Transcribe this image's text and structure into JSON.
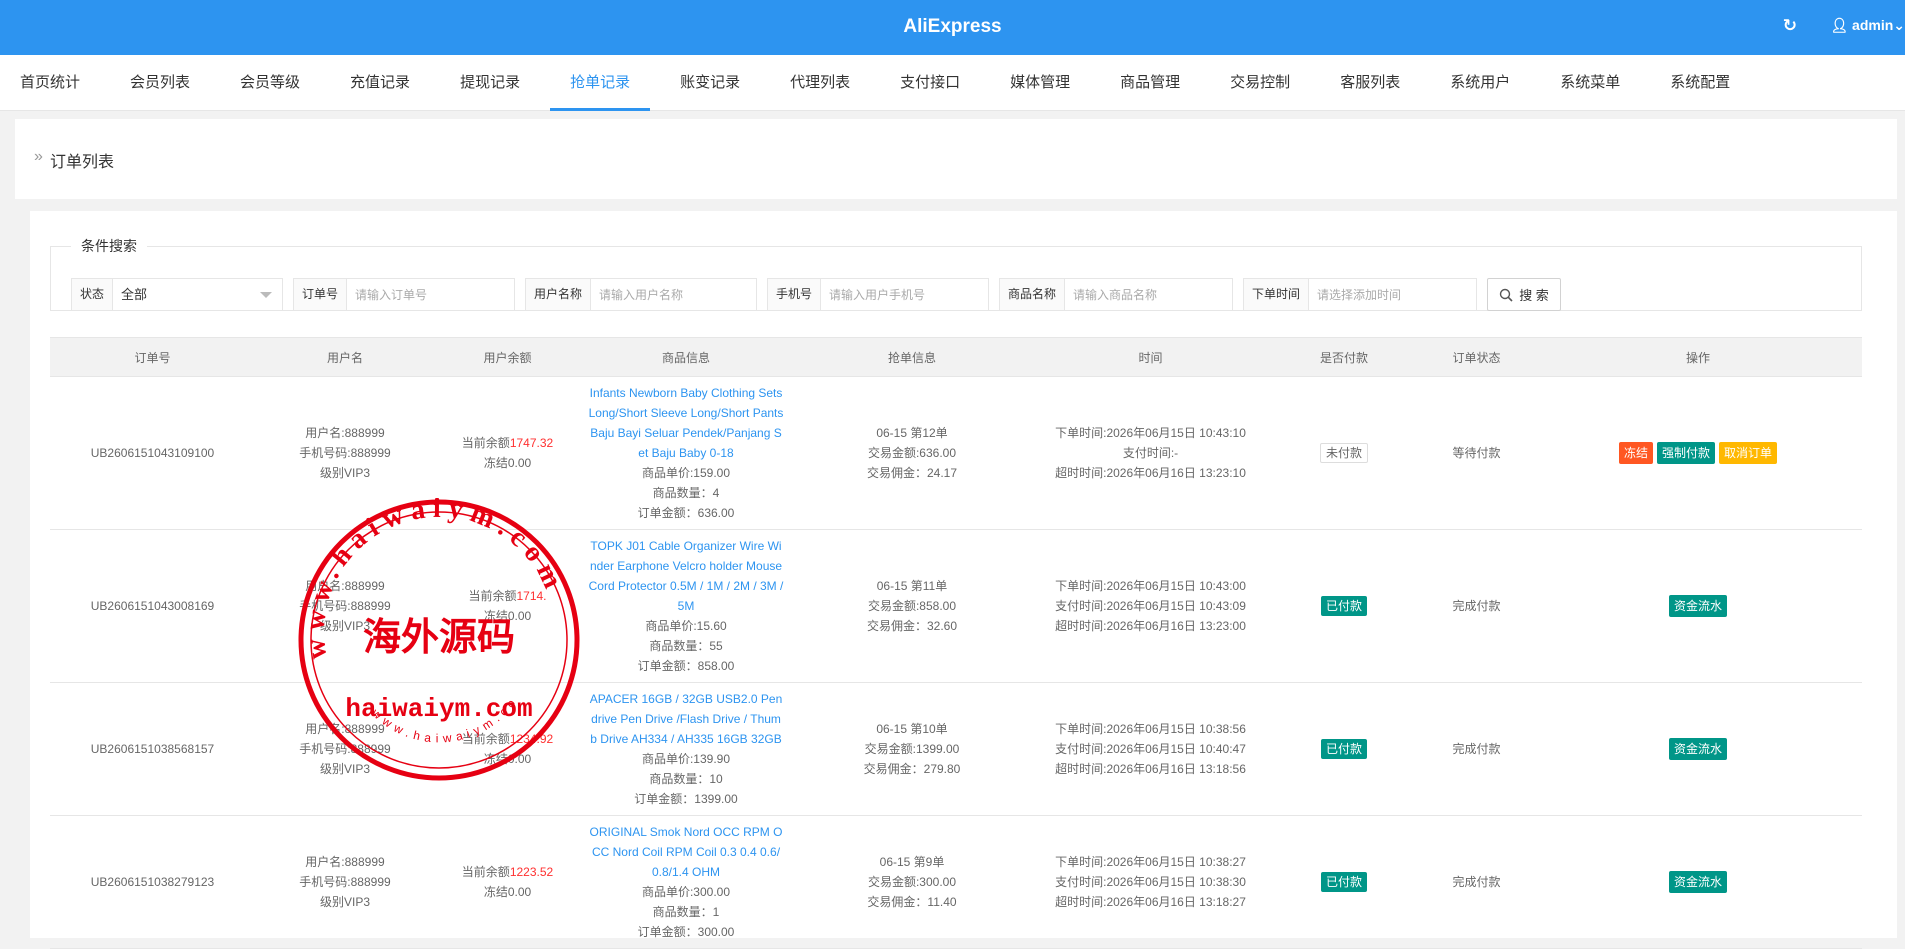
{
  "app": {
    "title": "AliExpress",
    "user": "admin"
  },
  "colors": {
    "primary": "#2d94f0",
    "green": "#009688",
    "orange": "#ff5722",
    "yellow": "#ffb800",
    "red": "#ff3030"
  },
  "nav": [
    {
      "label": "首页统计",
      "name": "nav-home-stats"
    },
    {
      "label": "会员列表",
      "name": "nav-member-list"
    },
    {
      "label": "会员等级",
      "name": "nav-member-level"
    },
    {
      "label": "充值记录",
      "name": "nav-recharge-records"
    },
    {
      "label": "提现记录",
      "name": "nav-withdraw-records"
    },
    {
      "label": "抢单记录",
      "name": "nav-grab-order-records",
      "active": true
    },
    {
      "label": "账变记录",
      "name": "nav-balance-change-records"
    },
    {
      "label": "代理列表",
      "name": "nav-agent-list"
    },
    {
      "label": "支付接口",
      "name": "nav-payment-interface"
    },
    {
      "label": "媒体管理",
      "name": "nav-media-management"
    },
    {
      "label": "商品管理",
      "name": "nav-product-management"
    },
    {
      "label": "交易控制",
      "name": "nav-trade-control"
    },
    {
      "label": "客服列表",
      "name": "nav-customer-service"
    },
    {
      "label": "系统用户",
      "name": "nav-system-users"
    },
    {
      "label": "系统菜单",
      "name": "nav-system-menu"
    },
    {
      "label": "系统配置",
      "name": "nav-system-config"
    }
  ],
  "breadcrumb": {
    "arrow": "»",
    "text": "订单列表"
  },
  "search": {
    "legend": "条件搜索",
    "status_label": "状态",
    "status_value": "全部",
    "order_label": "订单号",
    "order_placeholder": "请输入订单号",
    "username_label": "用户名称",
    "username_placeholder": "请输入用户名称",
    "phone_label": "手机号",
    "phone_placeholder": "请输入用户手机号",
    "product_label": "商品名称",
    "product_placeholder": "请输入商品名称",
    "time_label": "下单时间",
    "time_placeholder": "请选择添加时间",
    "button_label": "搜 索"
  },
  "table": {
    "columns": [
      "订单号",
      "用户名",
      "用户余额",
      "商品信息",
      "抢单信息",
      "时间",
      "是否付款",
      "订单状态",
      "操作"
    ],
    "rows": [
      {
        "order_no": "UB2606151043109100",
        "user": [
          "用户名:888999",
          "手机号码:888999",
          "级别VIP3"
        ],
        "balance_label": "当前余额",
        "balance_value": "1747.32",
        "frozen": "冻结0.00",
        "product_title": "Infants Newborn Baby Clothing Sets Long/Short Sleeve Long/Short Pants Baju Bayi Seluar Pendek/Panjang Set Baju Baby 0-18",
        "product_lines": [
          "商品单价:159.00",
          "商品数量：4",
          "订单金额：636.00"
        ],
        "grab": [
          "06-15 第12单",
          "交易金额:636.00",
          "交易佣金：24.17"
        ],
        "time": [
          "下单时间:2026年06月15日 10:43:10",
          "支付时间:-",
          "超时时间:2026年06月16日 13:23:10"
        ],
        "paid": "未付款",
        "paid_style": "gray",
        "status": "等待付款",
        "actions": [
          {
            "label": "冻结",
            "style": "orange",
            "name": "freeze-button"
          },
          {
            "label": "强制付款",
            "style": "green",
            "name": "force-pay-button"
          },
          {
            "label": "取消订单",
            "style": "yellow",
            "name": "cancel-order-button"
          }
        ]
      },
      {
        "order_no": "UB2606151043008169",
        "user": [
          "用户名:888999",
          "手机号码:888999",
          "级别VIP3"
        ],
        "balance_label": "当前余额",
        "balance_value": "1714.",
        "frozen": "冻结0.00",
        "product_title": "TOPK J01 Cable Organizer Wire Winder Earphone Velcro holder Mouse Cord Protector 0.5M / 1M / 2M / 3M /5M",
        "product_lines": [
          "商品单价:15.60",
          "商品数量：55",
          "订单金额：858.00"
        ],
        "grab": [
          "06-15 第11单",
          "交易金额:858.00",
          "交易佣金：32.60"
        ],
        "time": [
          "下单时间:2026年06月15日 10:43:00",
          "支付时间:2026年06月15日 10:43:09",
          "超时时间:2026年06月16日 13:23:00"
        ],
        "paid": "已付款",
        "paid_style": "green",
        "status": "完成付款",
        "actions": [
          {
            "label": "资金流水",
            "style": "green",
            "name": "fund-flow-button"
          }
        ]
      },
      {
        "order_no": "UB2606151038568157",
        "user": [
          "用户名:888999",
          "手机号码:888999",
          "级别VIP3"
        ],
        "balance_label": "当前余额",
        "balance_value": "1234.92",
        "frozen": "冻结0.00",
        "product_title": "APACER 16GB / 32GB USB2.0 Pendrive Pen Drive /Flash Drive / Thumb Drive AH334 / AH335 16GB 32GB",
        "product_lines": [
          "商品单价:139.90",
          "商品数量：10",
          "订单金额：1399.00"
        ],
        "grab": [
          "06-15 第10单",
          "交易金额:1399.00",
          "交易佣金：279.80"
        ],
        "time": [
          "下单时间:2026年06月15日 10:38:56",
          "支付时间:2026年06月15日 10:40:47",
          "超时时间:2026年06月16日 13:18:56"
        ],
        "paid": "已付款",
        "paid_style": "green",
        "status": "完成付款",
        "actions": [
          {
            "label": "资金流水",
            "style": "green",
            "name": "fund-flow-button"
          }
        ]
      },
      {
        "order_no": "UB2606151038279123",
        "user": [
          "用户名:888999",
          "手机号码:888999",
          "级别VIP3"
        ],
        "balance_label": "当前余额",
        "balance_value": "1223.52",
        "frozen": "冻结0.00",
        "product_title": "ORIGINAL Smok Nord OCC RPM OCC Nord Coil RPM Coil 0.3 0.4 0.6/0.8/1.4 OHM",
        "product_lines": [
          "商品单价:300.00",
          "商品数量：1",
          "订单金额：300.00"
        ],
        "grab": [
          "06-15 第9单",
          "交易金额:300.00",
          "交易佣金：11.40"
        ],
        "time": [
          "下单时间:2026年06月15日 10:38:27",
          "支付时间:2026年06月15日 10:38:30",
          "超时时间:2026年06月16日 13:18:27"
        ],
        "paid": "已付款",
        "paid_style": "green",
        "status": "完成付款",
        "actions": [
          {
            "label": "资金流水",
            "style": "green",
            "name": "fund-flow-button"
          }
        ]
      }
    ]
  },
  "watermark": {
    "ring_text": "www.haiwaiym.com",
    "center_text": "海外源码",
    "domain_text": "haiwaiym.com",
    "bottom_text": "www.haiwaiym.com"
  }
}
